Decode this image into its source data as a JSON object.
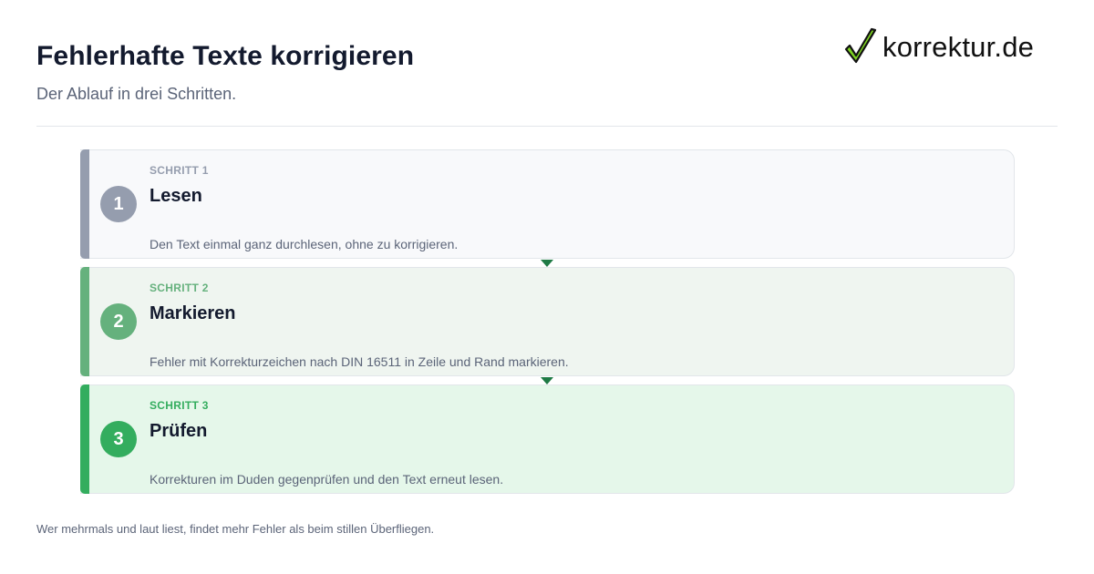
{
  "header": {
    "title": "Fehlerhafte Texte korrigieren",
    "subtitle": "Der Ablauf in drei Schritten."
  },
  "logo": {
    "text": "korrektur.de",
    "icon": "checkmark-icon"
  },
  "steps": [
    {
      "number": "1",
      "label": "SCHRITT 1",
      "title": "Lesen",
      "description": "Den Text einmal ganz durchlesen, ohne zu korrigieren.",
      "color": "#959dae"
    },
    {
      "number": "2",
      "label": "SCHRITT 2",
      "title": "Markieren",
      "description": "Fehler mit Korrekturzeichen nach DIN 16511 in Zeile und Rand markieren.",
      "color": "#65b17d"
    },
    {
      "number": "3",
      "label": "SCHRITT 3",
      "title": "Prüfen",
      "description": "Korrekturen im Duden gegenprüfen und den Text erneut lesen.",
      "color": "#33ad5e"
    }
  ],
  "footnote": "Wer mehrmals und laut liest, findet mehr Fehler als beim stillen Überfliegen.",
  "colors": {
    "title": "#131a2e",
    "muted": "#5b6478",
    "connector": "#1f7a45",
    "logo_check_fill": "#7ed321"
  }
}
